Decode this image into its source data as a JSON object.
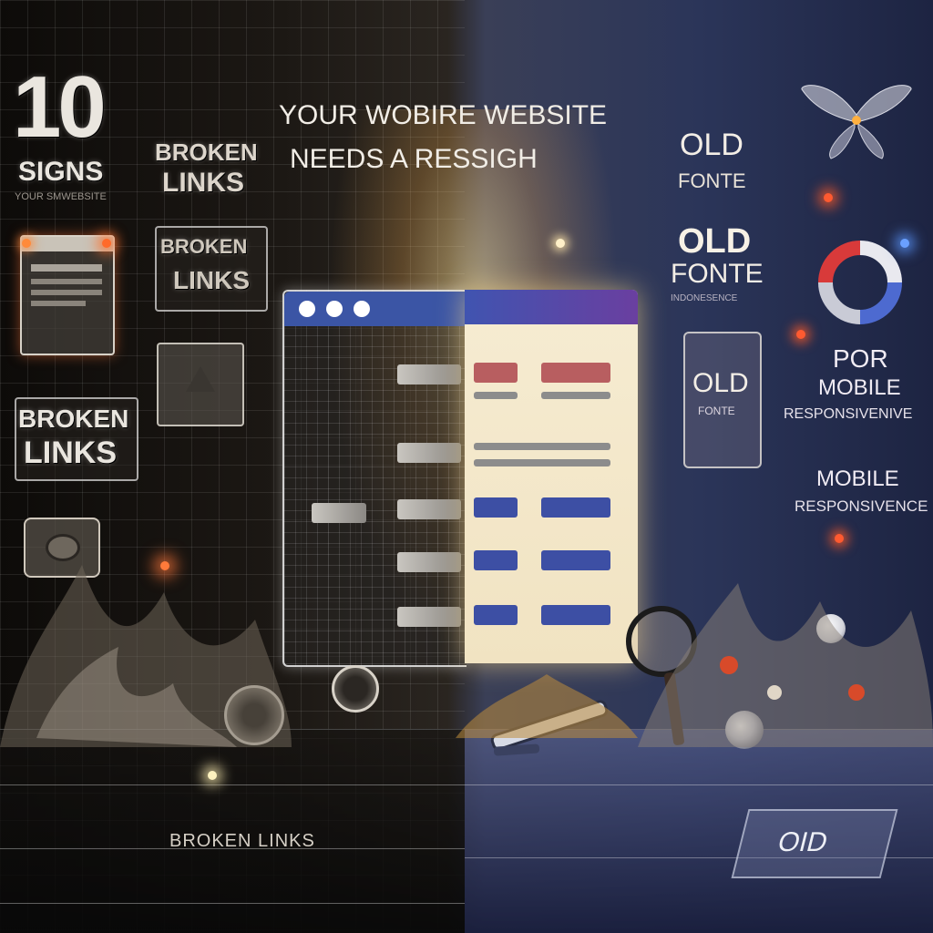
{
  "headline": {
    "number": "10",
    "signs": "SIGNS",
    "tagline": "YOUR SMWEBSITE",
    "title_line1": "YOUR WOBIRE WEBSITE",
    "title_line2": "NEEDS A RESSIGH"
  },
  "left_labels": {
    "broken_top": "BROKEN",
    "links_top": "LINKS",
    "broken_mid": "BROKEN",
    "links_mid": "LINKS",
    "broken_box": "BROKEN",
    "links_box": "LINKS",
    "floor": "BROKEN LINKS"
  },
  "right_labels": {
    "old1": "OLD",
    "fonte1": "FONTE",
    "old2": "OLD",
    "fonte2": "FONTE",
    "fonte2_sub": "INDONESENCE",
    "old_card": "OLD",
    "old_card_sub": "FONTE",
    "por": "POR",
    "mobile1": "MOBILE",
    "respon1": "RESPONSIVENIVE",
    "mobile2": "MOBILE",
    "respon2": "RESPONSIVENCE",
    "floor": "OID"
  },
  "colors": {
    "browser_bar": "#3b55a5",
    "browser_bar_right_end": "#6a3fa0",
    "accent_blue": "#3d4fa4",
    "accent_red": "#b85e60",
    "warm_glow": "#ffd98a"
  },
  "icons": [
    "browser-window-icon",
    "butterfly-icon",
    "donut-chart-icon",
    "magnifier-icon",
    "pencil-icon",
    "camera-icon",
    "eye-icon"
  ]
}
